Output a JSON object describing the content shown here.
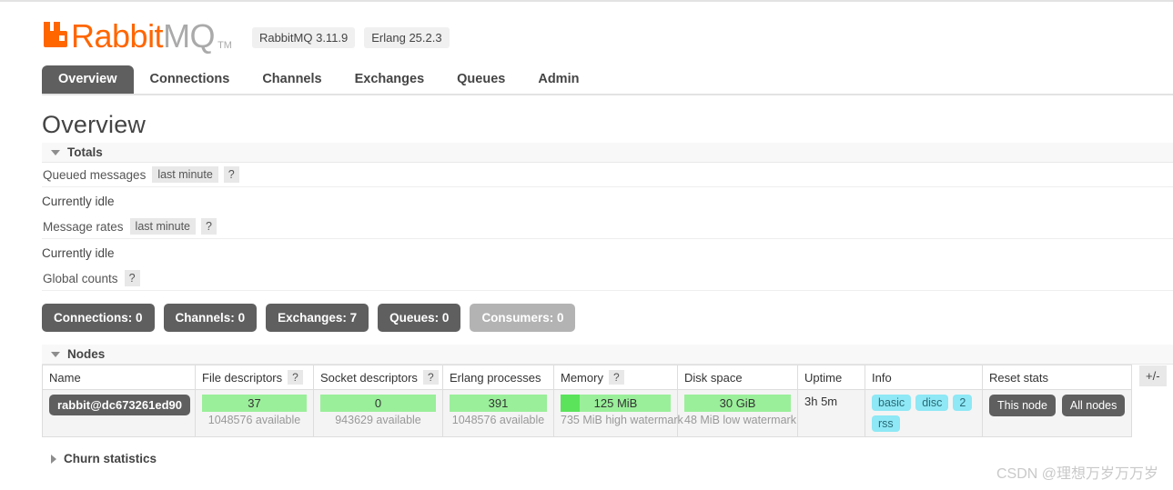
{
  "brand": {
    "logo_icon": "rabbitmq-logo-icon",
    "name_primary": "Rabbit",
    "name_secondary": "MQ",
    "trademark": "TM",
    "primary_color": "#ff6600",
    "secondary_color": "#aaaaaa",
    "version_pills": [
      "RabbitMQ 3.11.9",
      "Erlang 25.2.3"
    ]
  },
  "nav": {
    "tabs": [
      {
        "label": "Overview",
        "active": true
      },
      {
        "label": "Connections",
        "active": false
      },
      {
        "label": "Channels",
        "active": false
      },
      {
        "label": "Exchanges",
        "active": false
      },
      {
        "label": "Queues",
        "active": false
      },
      {
        "label": "Admin",
        "active": false
      }
    ]
  },
  "page": {
    "title": "Overview"
  },
  "totals": {
    "section_label": "Totals",
    "expanded": true,
    "queued_messages": {
      "label": "Queued messages",
      "period_chip": "last minute",
      "help_chip": "?",
      "status": "Currently idle"
    },
    "message_rates": {
      "label": "Message rates",
      "period_chip": "last minute",
      "help_chip": "?",
      "status": "Currently idle"
    },
    "global_counts": {
      "label": "Global counts",
      "help_chip": "?",
      "badges": [
        {
          "label": "Connections:",
          "value": "0",
          "muted": false
        },
        {
          "label": "Channels:",
          "value": "0",
          "muted": false
        },
        {
          "label": "Exchanges:",
          "value": "7",
          "muted": false
        },
        {
          "label": "Queues:",
          "value": "0",
          "muted": false
        },
        {
          "label": "Consumers:",
          "value": "0",
          "muted": true
        }
      ]
    }
  },
  "nodes": {
    "section_label": "Nodes",
    "expanded": true,
    "columns": [
      {
        "label": "Name",
        "help": null
      },
      {
        "label": "File descriptors",
        "help": "?"
      },
      {
        "label": "Socket descriptors",
        "help": "?"
      },
      {
        "label": "Erlang processes",
        "help": null
      },
      {
        "label": "Memory",
        "help": "?"
      },
      {
        "label": "Disk space",
        "help": null
      },
      {
        "label": "Uptime",
        "help": null
      },
      {
        "label": "Info",
        "help": null
      },
      {
        "label": "Reset stats",
        "help": null
      }
    ],
    "toggle_columns_label": "+/-",
    "row": {
      "name": "rabbit@dc673261ed90",
      "file_descriptors": {
        "value": "37",
        "sub": "1048576 available",
        "fill_pct": 0
      },
      "socket_descriptors": {
        "value": "0",
        "sub": "943629 available",
        "fill_pct": 0
      },
      "erlang_processes": {
        "value": "391",
        "sub": "1048576 available",
        "fill_pct": 0
      },
      "memory": {
        "value": "125 MiB",
        "sub": "735 MiB high watermark",
        "fill_pct": 17
      },
      "disk_space": {
        "value": "30 GiB",
        "sub": "48 MiB low watermark",
        "fill_pct": 0
      },
      "uptime": "3h 5m",
      "info_badges": [
        "basic",
        "disc",
        "2",
        "rss"
      ],
      "reset_buttons": [
        "This node",
        "All nodes"
      ]
    },
    "gauge_color": "#9aef9a",
    "gauge_fill_color": "#5be35b"
  },
  "churn": {
    "section_label": "Churn statistics",
    "expanded": false
  },
  "watermark": {
    "text": "CSDN @理想万岁万万岁"
  }
}
